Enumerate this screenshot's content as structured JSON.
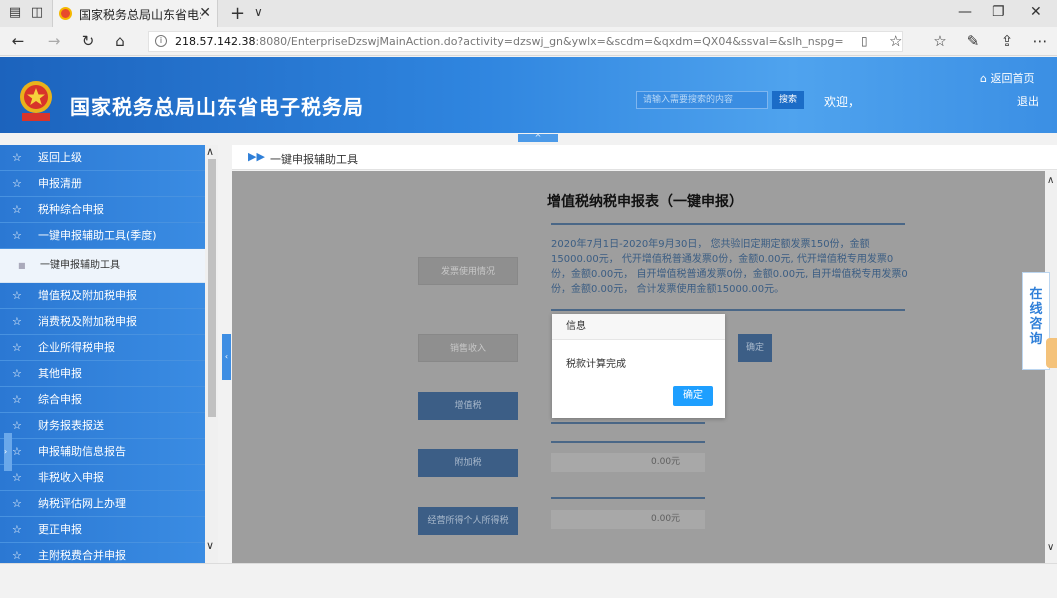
{
  "browser": {
    "tab_title": "国家税务总局山东省电:",
    "url_host": "218.57.142.38",
    "url_rest": ":8080/EnterpriseDzswjMainAction.do?activity=dzswj_gn&ywlx=&scdm=&qxdm=QX04&ssval=&slh_nspg="
  },
  "header": {
    "site_title": "国家税务总局山东省电子税务局",
    "search_placeholder": "请输入需要搜索的内容",
    "search_button": "搜索",
    "welcome": "欢迎，",
    "home_link": "返回首页",
    "logout_link": "退出"
  },
  "sidebar": {
    "items": [
      {
        "label": "返回上级",
        "sub": false
      },
      {
        "label": "申报清册",
        "sub": false
      },
      {
        "label": "税种综合申报",
        "sub": false
      },
      {
        "label": "一键申报辅助工具(季度)",
        "sub": false
      },
      {
        "label": "一键申报辅助工具",
        "sub": true
      },
      {
        "label": "增值税及附加税申报",
        "sub": false
      },
      {
        "label": "消费税及附加税申报",
        "sub": false
      },
      {
        "label": "企业所得税申报",
        "sub": false
      },
      {
        "label": "其他申报",
        "sub": false
      },
      {
        "label": "综合申报",
        "sub": false
      },
      {
        "label": "财务报表报送",
        "sub": false
      },
      {
        "label": "申报辅助信息报告",
        "sub": false
      },
      {
        "label": "非税收入申报",
        "sub": false
      },
      {
        "label": "纳税评估网上办理",
        "sub": false
      },
      {
        "label": "更正申报",
        "sub": false
      },
      {
        "label": "主附税费合并申报",
        "sub": false
      }
    ]
  },
  "breadcrumb": "一键申报辅助工具",
  "form": {
    "title": "增值税纳税申报表（一键申报）",
    "notice": "2020年7月1日-2020年9月30日， 您共验旧定期定额发票150份，金额15000.00元， 代开增值税普通发票0份，金额0.00元, 代开增值税专用发票0份，金额0.00元， 自开增值税普通发票0份，金额0.00元, 自开增值税专用发票0份，金额0.00元， 合计发票使用金额15000.00元。",
    "btn_invoice": "发票使用情况",
    "btn_sales": "销售收入",
    "btn_confirm": "确定",
    "btn_vat": "增值税",
    "btn_surtax": "附加税",
    "btn_iit": "经营所得个人所得税",
    "surtax_amount": "0.00元",
    "iit_amount": "0.00元"
  },
  "dialog": {
    "title": "信息",
    "message": "税款计算完成",
    "ok": "确定"
  },
  "consult": "在线咨询"
}
